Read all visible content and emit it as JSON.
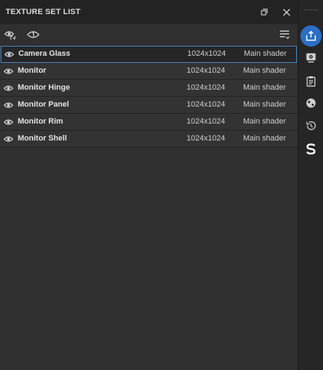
{
  "panel": {
    "title": "TEXTURE SET LIST"
  },
  "texture_sets": [
    {
      "name": "Camera Glass",
      "resolution": "1024x1024",
      "shader": "Main shader",
      "selected": true
    },
    {
      "name": "Monitor",
      "resolution": "1024x1024",
      "shader": "Main shader",
      "selected": false
    },
    {
      "name": "Monitor Hinge",
      "resolution": "1024x1024",
      "shader": "Main shader",
      "selected": false
    },
    {
      "name": "Monitor Panel",
      "resolution": "1024x1024",
      "shader": "Main shader",
      "selected": false
    },
    {
      "name": "Monitor Rim",
      "resolution": "1024x1024",
      "shader": "Main shader",
      "selected": false
    },
    {
      "name": "Monitor Shell",
      "resolution": "1024x1024",
      "shader": "Main shader",
      "selected": false
    }
  ],
  "sidebar": {
    "items": [
      {
        "icon": "export-icon",
        "active": true
      },
      {
        "icon": "display-settings-icon",
        "active": false
      },
      {
        "icon": "clipboard-icon",
        "active": false
      },
      {
        "icon": "globe-icon",
        "active": false
      },
      {
        "icon": "history-icon",
        "active": false
      },
      {
        "icon": "substance-logo-icon",
        "active": false
      }
    ]
  },
  "colors": {
    "accent": "#2b6fc6",
    "selection_outline": "#4a87c9",
    "panel_bg": "#303030",
    "titlebar_bg": "#232323"
  }
}
